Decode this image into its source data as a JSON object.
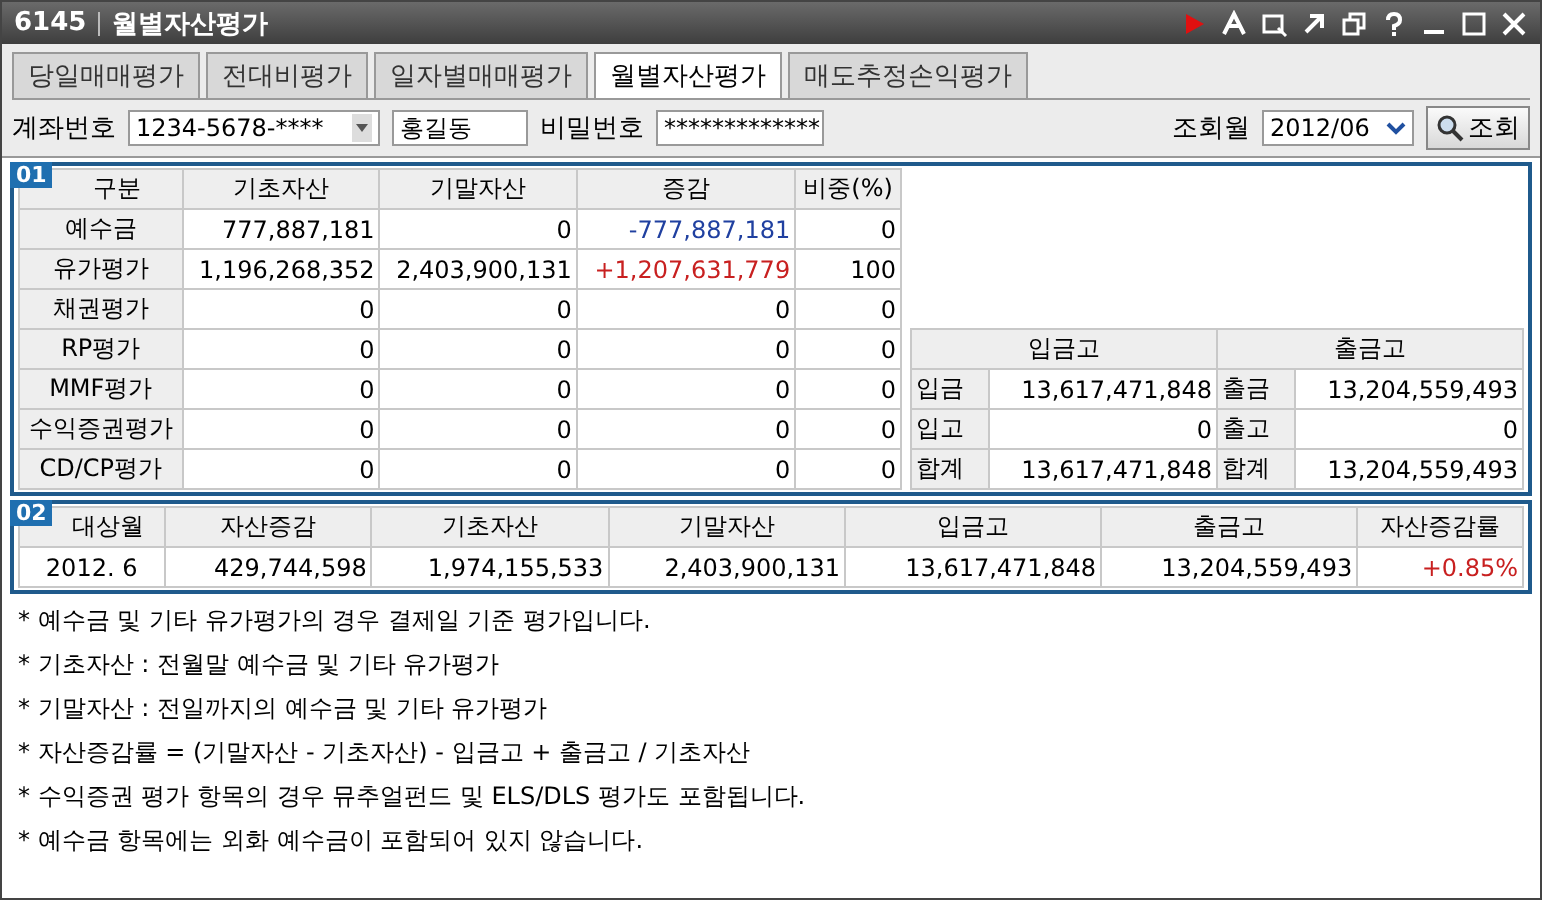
{
  "window": {
    "code": "6145",
    "title": "월별자산평가"
  },
  "tabs": [
    {
      "label": "당일매매평가",
      "selected": false
    },
    {
      "label": "전대비평가",
      "selected": false
    },
    {
      "label": "일자별매매평가",
      "selected": false
    },
    {
      "label": "월별자산평가",
      "selected": true
    },
    {
      "label": "매도추정손익평가",
      "selected": false
    }
  ],
  "form": {
    "account_label": "계좌번호",
    "account": "1234-5678-****",
    "name": "홍길동",
    "password_label": "비밀번호",
    "password": "*************",
    "month_label": "조회월",
    "month": "2012/06",
    "query_button": "조회"
  },
  "section1": {
    "badge": "01",
    "columns": [
      "구분",
      "기초자산",
      "기말자산",
      "증감",
      "비중(%)"
    ],
    "rows": [
      {
        "cells": [
          "예수금",
          "777,887,181",
          "0",
          "-777,887,181",
          "0"
        ],
        "color": "#2040a0"
      },
      {
        "cells": [
          "유가평가",
          "1,196,268,352",
          "2,403,900,131",
          "+1,207,631,779",
          "100"
        ],
        "color": "#c82020"
      },
      {
        "cells": [
          "채권평가",
          "0",
          "0",
          "0",
          "0"
        ],
        "color": "#000000"
      },
      {
        "cells": [
          "RP평가",
          "0",
          "0",
          "0",
          "0"
        ],
        "color": "#000000"
      },
      {
        "cells": [
          "MMF평가",
          "0",
          "0",
          "0",
          "0"
        ],
        "color": "#000000"
      },
      {
        "cells": [
          "수익증권평가",
          "0",
          "0",
          "0",
          "0"
        ],
        "color": "#000000"
      },
      {
        "cells": [
          "CD/CP평가",
          "0",
          "0",
          "0",
          "0"
        ],
        "color": "#000000"
      }
    ],
    "flow": {
      "headers": [
        "입금고",
        "출금고"
      ],
      "rows": [
        [
          "입금",
          "13,617,471,848",
          "출금",
          "13,204,559,493"
        ],
        [
          "입고",
          "0",
          "출고",
          "0"
        ],
        [
          "합계",
          "13,617,471,848",
          "합계",
          "13,204,559,493"
        ]
      ]
    }
  },
  "section2": {
    "badge": "02",
    "columns": [
      "대상월",
      "자산증감",
      "기초자산",
      "기말자산",
      "입금고",
      "출금고",
      "자산증감률"
    ],
    "row": {
      "cells": [
        "2012. 6",
        "429,744,598",
        "1,974,155,533",
        "2,403,900,131",
        "13,617,471,848",
        "13,204,559,493",
        "+0.85%"
      ],
      "color": "#c82020"
    }
  },
  "notes": [
    "* 예수금 및 기타 유가평가의 경우 결제일 기준 평가입니다.",
    "* 기초자산 : 전월말 예수금 및 기타 유가평가",
    "* 기말자산 : 전일까지의 예수금 및 기타 유가평가",
    "* 자산증감률 = (기말자산 - 기초자산) - 입금고 + 출금고 / 기초자산",
    "* 수익증권 평가 항목의 경우 뮤추얼펀드 및 ELS/DLS 평가도 포함됩니다.",
    "* 예수금 항목에는 외화 예수금이 포함되어 있지 않습니다."
  ]
}
